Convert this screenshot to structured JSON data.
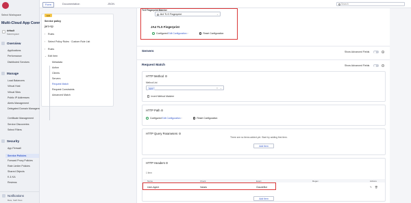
{
  "sidebar": {
    "workspace_label": "Select Workspace",
    "app_title": "Multi-Cloud App Connect",
    "namespace_line1": "default",
    "namespace_line2": "Namespace",
    "sections": [
      {
        "label": "Overview",
        "items": [
          "Applications",
          "Performance",
          "Distributed Services"
        ]
      },
      {
        "label": "Manage",
        "items": [
          "Load Balancers",
          "Virtual Host",
          "Virtual Sites",
          "Public IP Addresses",
          "Alerts Management",
          "Delegated Domain Management",
          "Certificate Management",
          "Service Discoveries",
          "Select Filters"
        ]
      },
      {
        "label": "Security",
        "items": [
          "App Firewall",
          "Service Policies",
          "Forward Proxy Policies",
          "Rate Limiter Policies",
          "Shared Objects",
          "K & KA",
          "Reviews"
        ]
      }
    ],
    "active_item": "Service Policies",
    "notifications_label": "Notifications",
    "notifications_sub": "Beta, Staff Pass"
  },
  "topbar": {
    "tabs": [
      "Form",
      "Documentation",
      "JSON"
    ],
    "search_placeholder": "Search"
  },
  "nav": {
    "badge": "Edit",
    "policy_title": "Service policy",
    "policy_name": "jaro-sp",
    "items": [
      {
        "label": "Rules",
        "chevron": "›"
      },
      {
        "label": "Select Policy Rules · Custom Rule List",
        "chevron": "›"
      },
      {
        "label": "Rules",
        "chevron": "›"
      },
      {
        "label": "Edit Item",
        "chevron": "⌄"
      }
    ],
    "sub_items": [
      "Metadata",
      "Action",
      "Clients",
      "Servers",
      "Request Match",
      "Request Constraints",
      "Advanced Match"
    ],
    "active_sub": "Request Match"
  },
  "tls": {
    "label": "TLS Fingerprint Matcher",
    "select_value": "JA4 TLS Fingerprint",
    "fingerprint_title": "JA4 TLS Fingerprint",
    "configured_text": "Configured",
    "edit_link": "Edit Configuration",
    "reset_label": "Reset Configuration"
  },
  "servers": {
    "title": "Servers",
    "advanced_label": "Show Advanced Fields"
  },
  "request_match": {
    "title": "Request Match",
    "advanced_label": "Show Advanced Fields",
    "http_method": {
      "title": "HTTP Method",
      "method_list_label": "Method List",
      "chip": "ANY",
      "invert_label": "Invert Method Matcher"
    },
    "http_path": {
      "title": "HTTP Path",
      "configured_text": "Configured",
      "edit_link": "Edit Configuration",
      "reset_label": "Reset Configuration"
    },
    "query_params": {
      "title": "HTTP Query Parameters",
      "empty_message": "There are no items added yet. Start by adding first item.",
      "add_label": "Add Item"
    },
    "http_headers": {
      "title": "HTTP Headers",
      "count": "1 Item",
      "columns": [
        "Name",
        "Check",
        "Exact",
        "Regex",
        "Actions"
      ],
      "rows": [
        {
          "name": "User-Agent",
          "check": "Values",
          "exact": "ClaudeBot",
          "regex": ""
        }
      ],
      "add_label": "Add Item"
    }
  },
  "colors": {
    "accent": "#3457c9",
    "highlight_border": "#d93434",
    "badge": "#f5c74c"
  }
}
